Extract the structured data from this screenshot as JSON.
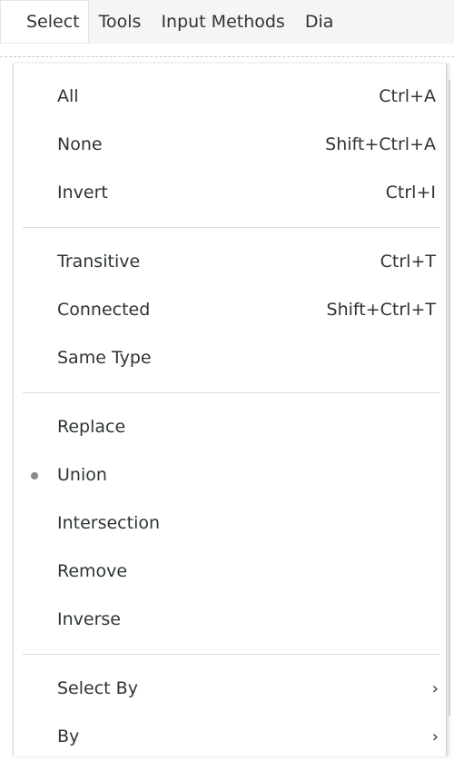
{
  "menubar": {
    "items": [
      {
        "label": "Select"
      },
      {
        "label": "Tools"
      },
      {
        "label": "Input Methods"
      },
      {
        "label": "Dia"
      }
    ]
  },
  "select_menu": {
    "group1": [
      {
        "label": "All",
        "accel": "Ctrl+A"
      },
      {
        "label": "None",
        "accel": "Shift+Ctrl+A"
      },
      {
        "label": "Invert",
        "accel": "Ctrl+I"
      }
    ],
    "group2": [
      {
        "label": "Transitive",
        "accel": "Ctrl+T"
      },
      {
        "label": "Connected",
        "accel": "Shift+Ctrl+T"
      },
      {
        "label": "Same Type",
        "accel": ""
      }
    ],
    "group3": [
      {
        "label": "Replace",
        "selected": false
      },
      {
        "label": "Union",
        "selected": true
      },
      {
        "label": "Intersection",
        "selected": false
      },
      {
        "label": "Remove",
        "selected": false
      },
      {
        "label": "Inverse",
        "selected": false
      }
    ],
    "group4": [
      {
        "label": "Select By",
        "arrow": "›"
      },
      {
        "label": "By",
        "arrow": "›"
      }
    ]
  },
  "colors": {
    "text": "#2e3436",
    "radio_indicator": "#8a8a8a",
    "separator": "#dcdcdc",
    "menubar_bg": "#f6f5f4"
  },
  "icons": {
    "radio": "radio-dot-icon",
    "submenu": "chevron-right-icon"
  }
}
